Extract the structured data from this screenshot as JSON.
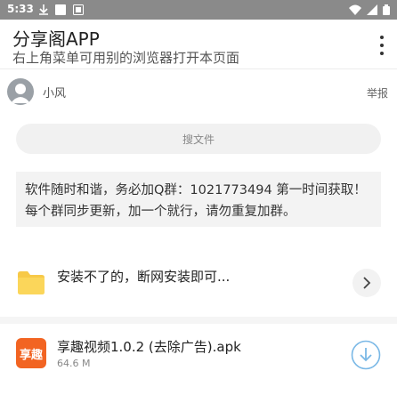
{
  "status_bar": {
    "time": "5:33",
    "left_icons": [
      "download-icon",
      "square-notification-icon",
      "media-notification-icon"
    ],
    "right_icons": [
      "wifi-icon",
      "signal-icon",
      "battery-icon"
    ]
  },
  "app_bar": {
    "title": "分享阁APP",
    "subtitle": "右上角菜单可用别的浏览器打开本页面",
    "menu_icon": "more-vert-icon"
  },
  "user": {
    "avatar_icon": "person-avatar-icon",
    "name": "小风",
    "report_label": "举报"
  },
  "search": {
    "placeholder": "搜文件"
  },
  "notice": {
    "text": "软件随时和谐，务必加Q群：1021773494 第一时间获取！每个群同步更新，加一个就行，请勿重复加群。"
  },
  "files": [
    {
      "name": "安装不了的，断网安装即可...",
      "icon": "folder-icon",
      "action_icon": "chevron-right-icon",
      "color": "#f7c948"
    },
    {
      "name": "享趣视频1.0.2 (去除广告).apk",
      "size": "64.6 M",
      "icon_label": "享趣",
      "action_icon": "download-circle-icon",
      "color": "#f26422",
      "action_color": "#7ab8e6"
    }
  ]
}
